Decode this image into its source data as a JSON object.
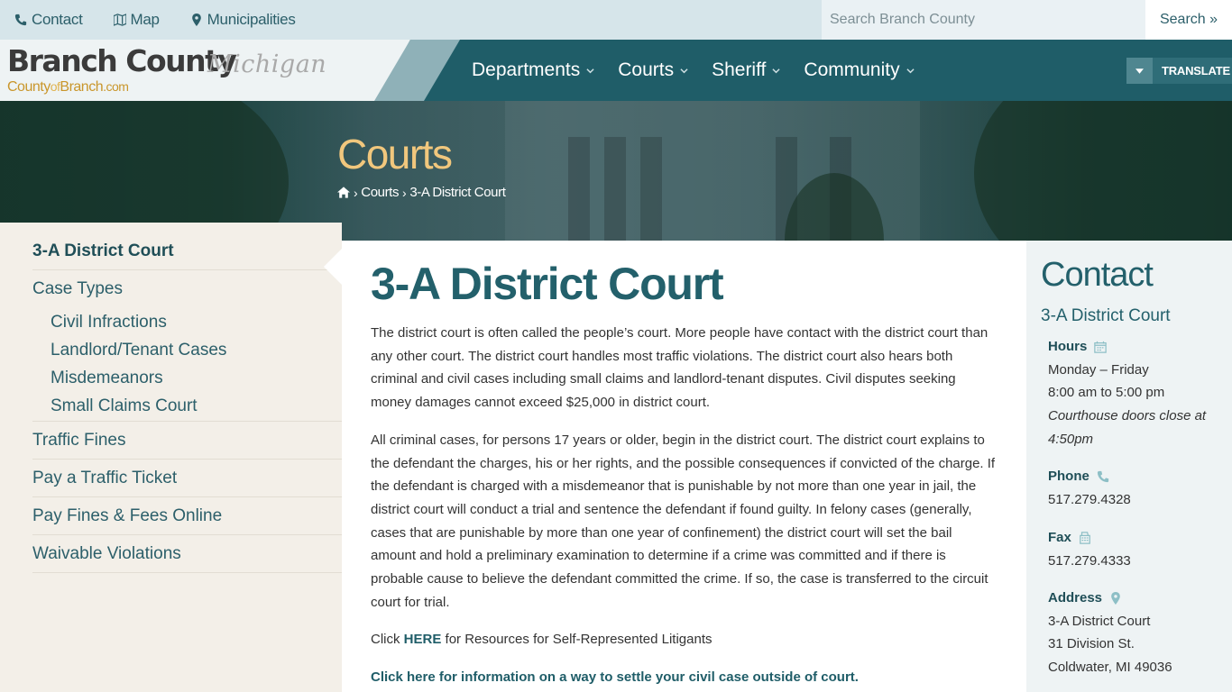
{
  "topbar": {
    "links": [
      {
        "label": "Contact",
        "icon": "phone-icon"
      },
      {
        "label": "Map",
        "icon": "map-icon"
      },
      {
        "label": "Municipalities",
        "icon": "map-marker-icon"
      }
    ],
    "search_placeholder": "Search Branch County",
    "search_label": "Search »"
  },
  "header": {
    "logo_main": "Branch County",
    "logo_state": "Michigan",
    "logo_url_a": "County",
    "logo_url_of": "of",
    "logo_url_b": "Branch",
    "logo_url_com": ".com",
    "nav": [
      {
        "label": "Departments"
      },
      {
        "label": "Courts"
      },
      {
        "label": "Sheriff"
      },
      {
        "label": "Community"
      }
    ],
    "translate_label": "TRANSLATE"
  },
  "hero": {
    "title": "Courts",
    "breadcrumb": [
      "Courts",
      "3-A District Court"
    ]
  },
  "sidebar": {
    "active": "3-A District Court",
    "group": "Case Types",
    "sub_items": [
      "Civil Infractions",
      "Landlord/Tenant Cases",
      "Misdemeanors",
      "Small Claims Court"
    ],
    "items": [
      "Traffic Fines",
      "Pay a Traffic Ticket",
      "Pay Fines & Fees Online",
      "Waivable Violations"
    ]
  },
  "main": {
    "title": "3-A District Court",
    "para1": "The district court is often called the people’s court. More people have contact with the district court than any other court. The district court handles most traffic violations. The district court also hears both criminal and civil cases including small claims and landlord-tenant disputes. Civil disputes seeking money damages cannot exceed $25,000 in district court.",
    "para2": "All criminal cases, for persons 17 years or older, begin in the district court. The district court explains to the defendant the charges, his or her rights, and the possible consequences if convicted of the charge. If the defendant is charged with a misdemeanor that is punishable by not more than one year in jail, the district court will conduct a trial and sentence the defendant if found guilty. In felony cases (generally, cases that are punishable by more than one year of confinement) the district court will set the bail amount and hold a preliminary examination to determine if a crime was committed and if there is probable cause to believe the defendant committed the crime. If so, the case is transferred to the circuit court for trial.",
    "para3_prefix": "Click ",
    "para3_link": "HERE",
    "para3_suffix": " for Resources for Self-Represented Litigants",
    "para4_link": "Click here for information on a way to settle your civil case outside of court."
  },
  "contact": {
    "title": "Contact",
    "org": "3-A District Court",
    "hours_label": "Hours",
    "hours_days": "Monday – Friday",
    "hours_time": "8:00 am to 5:00 pm",
    "hours_note": "Courthouse doors close at 4:50pm",
    "phone_label": "Phone",
    "phone": "517.279.4328",
    "fax_label": "Fax",
    "fax": "517.279.4333",
    "address_label": "Address",
    "address_line1": "3-A District Court",
    "address_line2": "31 Division St.",
    "address_line3": "Coldwater, MI 49036"
  },
  "colors": {
    "primary": "#1f5d68",
    "accent_gold": "#f1c77d",
    "sidebar_bg": "#f3efe8",
    "contact_bg": "#eef3f4"
  }
}
